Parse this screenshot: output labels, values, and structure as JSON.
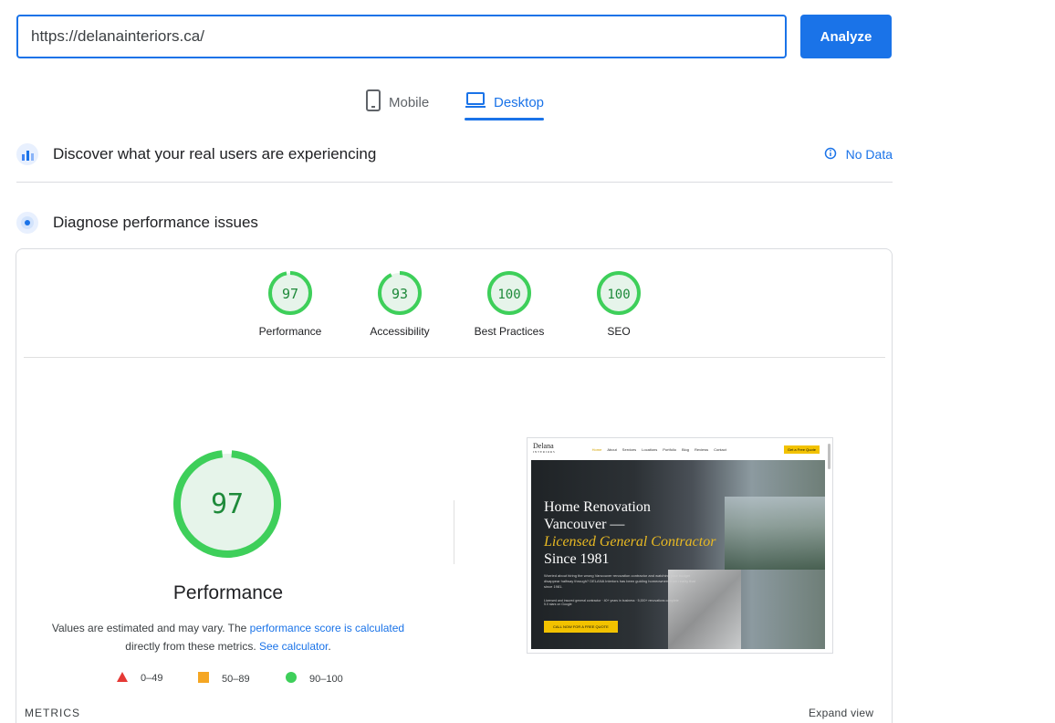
{
  "url_bar": {
    "value": "https://delanainteriors.ca/",
    "analyze_label": "Analyze"
  },
  "device_tabs": [
    {
      "label": "Mobile",
      "icon": "phone-icon",
      "selected": false
    },
    {
      "label": "Desktop",
      "icon": "laptop-icon",
      "selected": true
    }
  ],
  "field_data": {
    "title": "Discover what your real users are experiencing",
    "status": "No Data",
    "status_icon": "info-icon"
  },
  "lab_data": {
    "title": "Diagnose performance issues"
  },
  "categories": [
    {
      "label": "Performance",
      "score": "97"
    },
    {
      "label": "Accessibility",
      "score": "93"
    },
    {
      "label": "Best Practices",
      "score": "100"
    },
    {
      "label": "SEO",
      "score": "100"
    }
  ],
  "performance": {
    "score": "97",
    "title": "Performance",
    "note_prefix": "Values are estimated and may vary. The ",
    "note_link1": "performance score is calculated",
    "note_middle": " directly from these metrics. ",
    "note_link2": "See calculator",
    "note_suffix": "."
  },
  "legend": [
    {
      "range": "0–49",
      "shape": "triangle",
      "color": "#e53935"
    },
    {
      "range": "50–89",
      "shape": "square",
      "color": "#f5a623"
    },
    {
      "range": "90–100",
      "shape": "circle",
      "color": "#3ecf5a"
    }
  ],
  "metrics_label": "METRICS",
  "expand_label": "Expand view",
  "thumbnail": {
    "logo": "Delana",
    "logo_sub": "INTERIORS",
    "nav": [
      "Home",
      "About",
      "Services",
      "Locations",
      "Portfolio",
      "Blog",
      "Reviews",
      "Contact"
    ],
    "cta": "Get a Free Quote",
    "hero_line1": "Home Renovation",
    "hero_line2": "Vancouver —",
    "hero_line3": "Licensed General Contractor",
    "hero_line4": "Since 1981",
    "hero_body": "Worried about hiring the wrong Vancouver renovation contractor and watching your budget disappear halfway through? DELANA Interiors has been guiding homeowners from reality that since 1981.",
    "bullets": [
      "Licensed and insured general contractor",
      "40+ years in business",
      "5,000+ renovations complete",
      "5.0 stars on Google"
    ],
    "button": "CALL NOW FOR A FREE QUOTE"
  },
  "colors": {
    "accent": "#1a73e8",
    "pass": "#0cce6b",
    "gauge_fill": "#e6f4ea"
  }
}
